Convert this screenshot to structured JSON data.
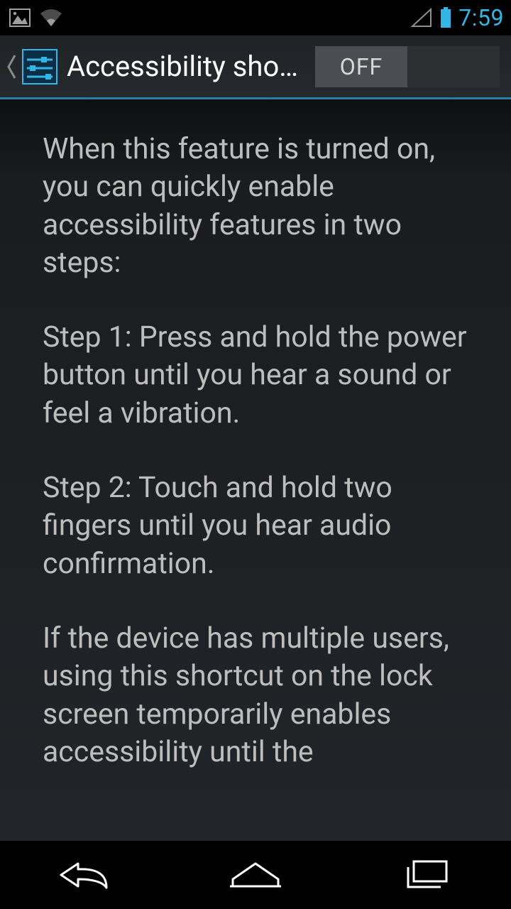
{
  "status": {
    "time": "7:59"
  },
  "actionbar": {
    "title": "Accessibility shortc…",
    "toggle_label": "OFF",
    "toggle_state": "off"
  },
  "content": {
    "p1": "When this feature is turned on, you can quickly enable accessibility features in two steps:",
    "p2": "Step 1: Press and hold the power button until you hear a sound or feel a vibration.",
    "p3": "Step 2: Touch and hold two fingers until you hear audio confirmation.",
    "p4": "If the device has multiple users, using this shortcut on the lock screen temporarily enables accessibility until the"
  }
}
